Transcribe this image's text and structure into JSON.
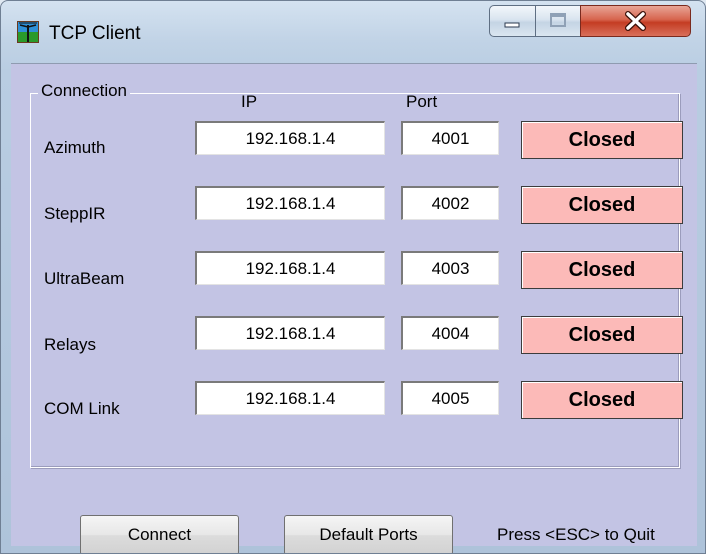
{
  "window": {
    "title": "TCP Client"
  },
  "connection": {
    "group_label": "Connection",
    "ip_header": "IP",
    "port_header": "Port",
    "rows": [
      {
        "label": "Azimuth",
        "ip": "192.168.1.4",
        "port": "4001",
        "status": "Closed"
      },
      {
        "label": "SteppIR",
        "ip": "192.168.1.4",
        "port": "4002",
        "status": "Closed"
      },
      {
        "label": "UltraBeam",
        "ip": "192.168.1.4",
        "port": "4003",
        "status": "Closed"
      },
      {
        "label": "Relays",
        "ip": "192.168.1.4",
        "port": "4004",
        "status": "Closed"
      },
      {
        "label": "COM Link",
        "ip": "192.168.1.4",
        "port": "4005",
        "status": "Closed"
      }
    ]
  },
  "buttons": {
    "connect": "Connect",
    "default_ports": "Default Ports"
  },
  "hint": "Press <ESC> to Quit",
  "colors": {
    "status_closed": "#fcbab8",
    "client_background": "#c3c4e4"
  },
  "icons": {
    "app": "antenna-tower-icon",
    "minimize": "minimize-icon",
    "maximize": "maximize-icon",
    "close": "close-icon"
  }
}
